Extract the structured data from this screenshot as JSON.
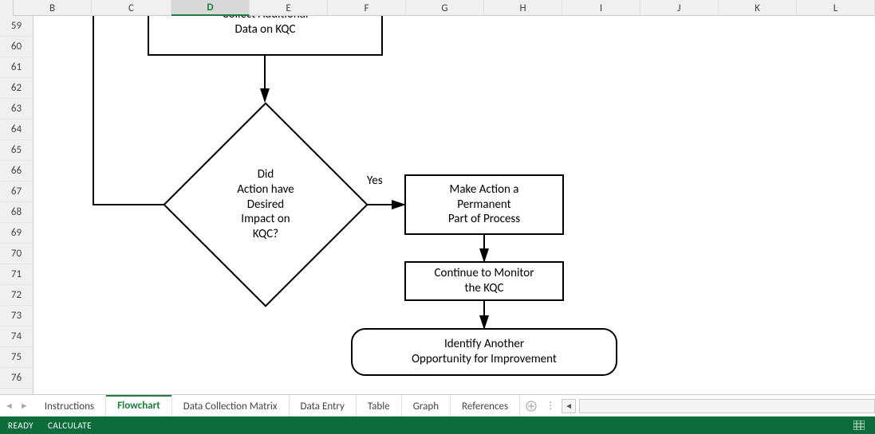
{
  "columns": [
    {
      "label": "B",
      "width": 98
    },
    {
      "label": "C",
      "width": 100
    },
    {
      "label": "D",
      "width": 98,
      "active": true
    },
    {
      "label": "E",
      "width": 98
    },
    {
      "label": "F",
      "width": 98
    },
    {
      "label": "G",
      "width": 98
    },
    {
      "label": "H",
      "width": 98
    },
    {
      "label": "I",
      "width": 98
    },
    {
      "label": "J",
      "width": 98
    },
    {
      "label": "K",
      "width": 98
    },
    {
      "label": "L",
      "width": 98
    }
  ],
  "rows": [
    "59",
    "60",
    "61",
    "62",
    "63",
    "64",
    "65",
    "66",
    "67",
    "68",
    "69",
    "70",
    "71",
    "72",
    "73",
    "74",
    "75",
    "76"
  ],
  "flow": {
    "box_collect": "Collect Additional\nData on KQC",
    "decision": "Did\nAction have\nDesired\nImpact on\nKQC?",
    "yes": "Yes",
    "box_perm": "Make Action a\nPermanent\nPart of Process",
    "box_monitor": "Continue to Monitor\nthe KQC",
    "box_identify": "Identify Another\nOpportunity for Improvement"
  },
  "tabs": {
    "items": [
      "Instructions",
      "Flowchart",
      "Data Collection Matrix",
      "Data Entry",
      "Table",
      "Graph",
      "References"
    ],
    "active_index": 1
  },
  "status": {
    "ready": "READY",
    "calc": "CALCULATE"
  }
}
